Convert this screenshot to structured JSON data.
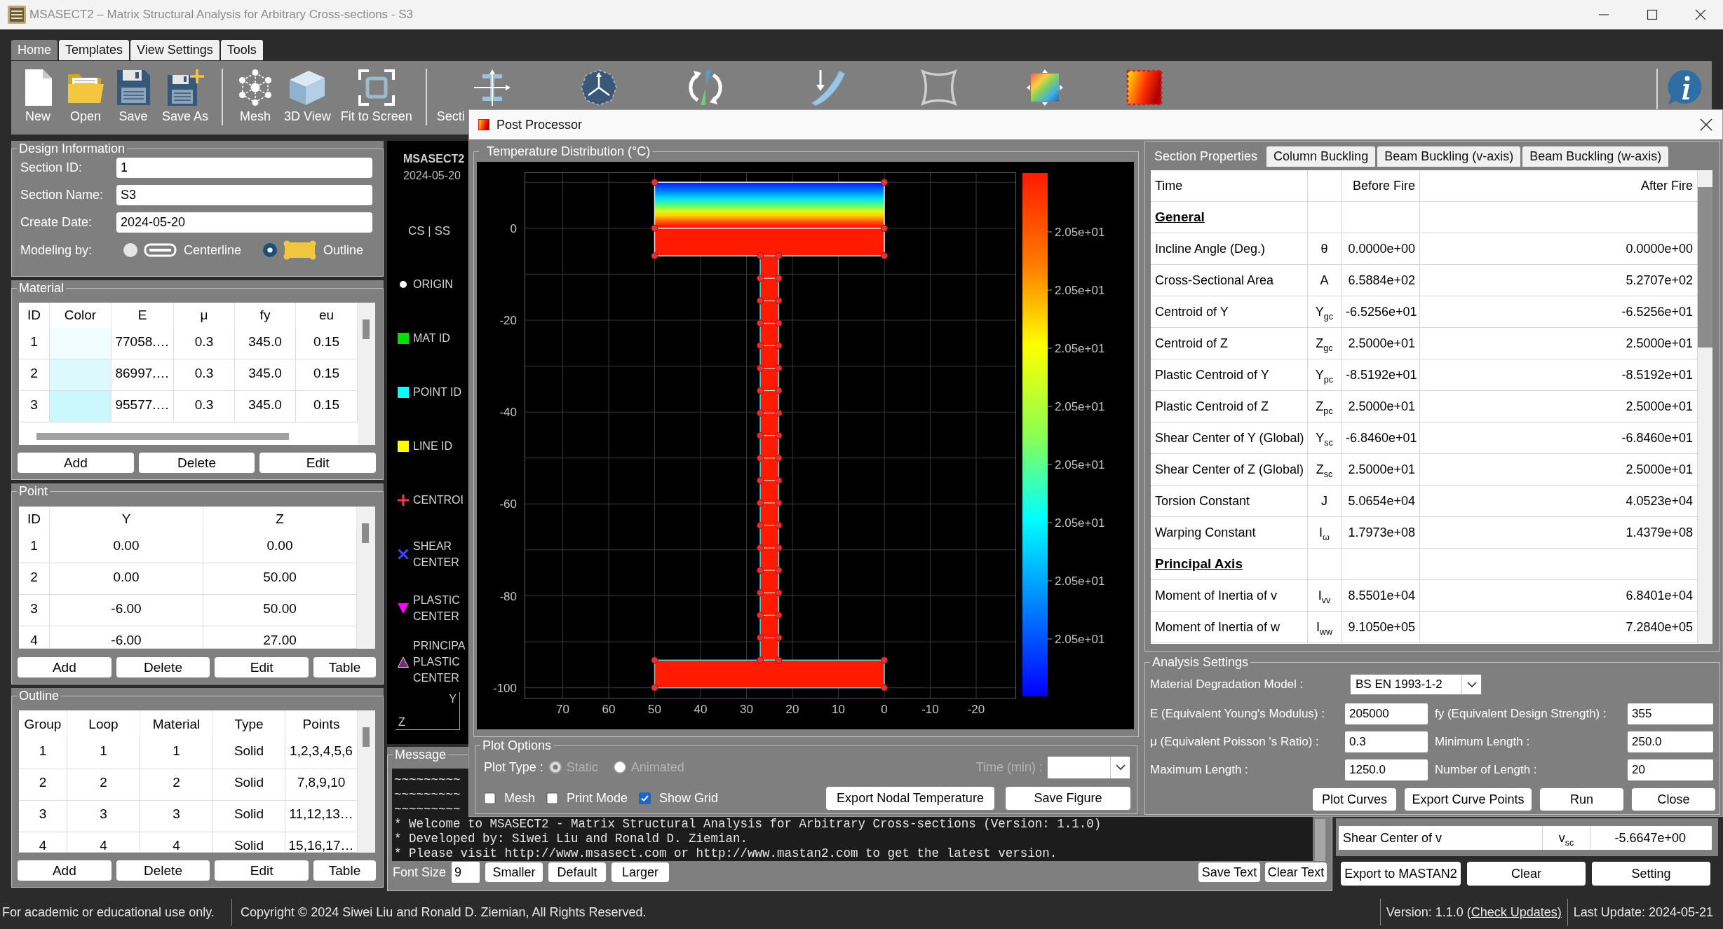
{
  "window": {
    "title": "MSASECT2 – Matrix Structural Analysis for Arbitrary Cross-sections - S3"
  },
  "ribbon": {
    "tabs": [
      {
        "label": "Home",
        "selected": true
      },
      {
        "label": "Templates",
        "selected": false
      },
      {
        "label": "View Settings",
        "selected": false
      },
      {
        "label": "Tools",
        "selected": false
      }
    ],
    "groups": [
      {
        "buttons": [
          {
            "kind": "new",
            "label": "New"
          },
          {
            "kind": "open",
            "label": "Open"
          },
          {
            "kind": "save",
            "label": "Save"
          },
          {
            "kind": "save_as",
            "label": "Save As"
          }
        ]
      },
      {
        "buttons": [
          {
            "kind": "mesh",
            "label": "Mesh"
          },
          {
            "kind": "view_3d",
            "label": "3D View"
          },
          {
            "kind": "fit",
            "label": "Fit to Screen"
          }
        ]
      },
      {
        "buttons": [
          {
            "kind": "section",
            "label": "Secti"
          },
          {
            "kind": "axes"
          },
          {
            "kind": "rotation"
          },
          {
            "kind": "curved_beam"
          },
          {
            "kind": "warping"
          },
          {
            "kind": "gradient"
          },
          {
            "kind": "heat_map"
          }
        ]
      }
    ]
  },
  "design_information": {
    "title": "Design Information",
    "fields": [
      {
        "label": "Section ID:",
        "value": "1"
      },
      {
        "label": "Section Name:",
        "value": "S3"
      },
      {
        "label": "Create Date:",
        "value": "2024-05-20"
      }
    ],
    "modeling": {
      "label": "Modeling by:",
      "options": [
        {
          "kind": "centerline",
          "label": "Centerline",
          "selected": false
        },
        {
          "kind": "outline",
          "label": "Outline",
          "selected": true
        }
      ]
    }
  },
  "material": {
    "title": "Material",
    "columns": [
      "ID",
      "Color",
      "E",
      "μ",
      "fy",
      "eu"
    ],
    "rows": [
      {
        "id": "1",
        "color": "#effdfe",
        "e": "77058.…",
        "mu": "0.3",
        "fy": "345.0",
        "eu": "0.15"
      },
      {
        "id": "2",
        "color": "#dcfafd",
        "e": "86997.…",
        "mu": "0.3",
        "fy": "345.0",
        "eu": "0.15"
      },
      {
        "id": "3",
        "color": "#cbf8fd",
        "e": "95577.…",
        "mu": "0.3",
        "fy": "345.0",
        "eu": "0.15"
      }
    ],
    "buttons": [
      "Add",
      "Delete",
      "Edit"
    ]
  },
  "point": {
    "title": "Point",
    "columns": [
      "ID",
      "Y",
      "Z"
    ],
    "rows": [
      [
        "1",
        "0.00",
        "0.00"
      ],
      [
        "2",
        "0.00",
        "50.00"
      ],
      [
        "3",
        "-6.00",
        "50.00"
      ],
      [
        "4",
        "-6.00",
        "27.00"
      ]
    ],
    "buttons": [
      "Add",
      "Delete",
      "Edit",
      "Table"
    ]
  },
  "outline": {
    "title": "Outline",
    "columns": [
      "Group",
      "Loop",
      "Material",
      "Type",
      "Points"
    ],
    "rows": [
      [
        "1",
        "1",
        "1",
        "Solid",
        "1,2,3,4,5,6"
      ],
      [
        "2",
        "2",
        "2",
        "Solid",
        "7,8,9,10"
      ],
      [
        "3",
        "3",
        "3",
        "Solid",
        "11,12,13…"
      ],
      [
        "4",
        "4",
        "4",
        "Solid",
        "15,16,17…"
      ]
    ],
    "buttons": [
      "Add",
      "Delete",
      "Edit",
      "Table"
    ]
  },
  "legend": {
    "title": "MSASECT2",
    "date": "2024-05-20",
    "mode": "CS | SS",
    "items": [
      {
        "kind": "dot",
        "color": "#ffffff",
        "label": "ORIGIN"
      },
      {
        "kind": "square",
        "color": "#00e000",
        "label": "MAT ID"
      },
      {
        "kind": "square",
        "color": "#00ffff",
        "label": "POINT ID"
      },
      {
        "kind": "square",
        "color": "#ffff00",
        "label": "LINE ID"
      },
      {
        "kind": "plus",
        "color": "#ff3b3b",
        "label": "CENTROI"
      },
      {
        "kind": "cross",
        "color": "#3b4bff",
        "label": "SHEAR CENTER"
      },
      {
        "kind": "triangle_down",
        "color": "#ff00ff",
        "label": "PLASTIC CENTER"
      },
      {
        "kind": "triangle_up",
        "color": "#7a2a7a",
        "label": "PRINCIPA PLASTIC CENTER"
      }
    ],
    "axes": {
      "y": "Y",
      "z": "Z"
    }
  },
  "message": {
    "title": "Message",
    "lines": [
      "~~~~~~~~~",
      "~~~~~~~~~",
      "~~~~~~~~~",
      "* Welcome to MSASECT2 - Matrix Structural Analysis for Arbitrary Cross-sections (Version: 1.1.0)",
      "* Developed by: Siwei Liu and Ronald D. Ziemian.",
      "* Please visit http://www.msasect.com or http://www.mastan2.com to get the latest version."
    ],
    "font_size": {
      "label": "Font Size",
      "value": "9"
    },
    "buttons": [
      "Smaller",
      "Default",
      "Larger"
    ],
    "log_buttons": [
      "Save Text",
      "Clear Text"
    ]
  },
  "section_properties": {
    "row": {
      "label": "Shear Center of v",
      "symbol": "v$_{sc}$",
      "value": "-5.6647e+00"
    },
    "buttons": [
      "Export to MASTAN2",
      "Clear",
      "Setting"
    ]
  },
  "post_processor": {
    "title": "Post Processor",
    "plot": {
      "title": "Temperature Distribution (°C)",
      "x_ticks": [
        "70",
        "60",
        "50",
        "40",
        "30",
        "20",
        "10",
        "0",
        "-10",
        "-20"
      ],
      "y_ticks": [
        "0",
        "-20",
        "-40",
        "-60",
        "-80",
        "-100"
      ],
      "colorbar_labels": [
        "2.05e+01",
        "2.05e+01",
        "2.05e+01",
        "2.05e+01",
        "2.05e+01",
        "2.05e+01",
        "2.05e+01",
        "2.05e+01"
      ]
    },
    "plot_options": {
      "title": "Plot Options",
      "plot_type": {
        "label": "Plot Type :",
        "options": [
          {
            "label": "Static",
            "selected": true,
            "disabled": true
          },
          {
            "label": "Animated",
            "selected": false,
            "disabled": true
          }
        ]
      },
      "time": {
        "label": "Time (min) :",
        "disabled": true
      },
      "checkboxes": [
        {
          "label": "Mesh",
          "checked": false
        },
        {
          "label": "Print Mode",
          "checked": false
        },
        {
          "label": "Show Grid",
          "checked": true
        }
      ],
      "buttons": [
        "Export Nodal Temperature",
        "Save Figure"
      ]
    },
    "tabs": [
      {
        "label": "Section Properties",
        "selected": true
      },
      {
        "label": "Column Buckling",
        "selected": false
      },
      {
        "label": "Beam Buckling (v-axis)",
        "selected": false
      },
      {
        "label": "Beam Buckling (w-axis)",
        "selected": false
      }
    ],
    "table": {
      "header": {
        "label": "Time",
        "before": "Before Fire",
        "after": "After Fire"
      },
      "rows": [
        {
          "kind": "heading",
          "label": "General"
        },
        {
          "kind": "value",
          "label": "Incline Angle (Deg.)",
          "symbol": "θ",
          "before": "0.0000e+00",
          "after": "0.0000e+00"
        },
        {
          "kind": "value",
          "label": "Cross-Sectional Area",
          "symbol": "A",
          "before": "6.5884e+02",
          "after": "5.2707e+02"
        },
        {
          "kind": "value",
          "label": "Centroid of Y",
          "symbol": "Y$_{gc}$",
          "before": "-6.5256e+01",
          "after": "-6.5256e+01"
        },
        {
          "kind": "value",
          "label": "Centroid of Z",
          "symbol": "Z$_{gc}$",
          "before": "2.5000e+01",
          "after": "2.5000e+01"
        },
        {
          "kind": "value",
          "label": "Plastic Centroid of Y",
          "symbol": "Y$_{pc}$",
          "before": "-8.5192e+01",
          "after": "-8.5192e+01"
        },
        {
          "kind": "value",
          "label": "Plastic Centroid of Z",
          "symbol": "Z$_{pc}$",
          "before": "2.5000e+01",
          "after": "2.5000e+01"
        },
        {
          "kind": "value",
          "label": "Shear Center of Y (Global)",
          "symbol": "Y$_{sc}$",
          "before": "-6.8460e+01",
          "after": "-6.8460e+01"
        },
        {
          "kind": "value",
          "label": "Shear Center of Z (Global)",
          "symbol": "Z$_{sc}$",
          "before": "2.5000e+01",
          "after": "2.5000e+01"
        },
        {
          "kind": "value",
          "label": "Torsion Constant",
          "symbol": "J",
          "before": "5.0654e+04",
          "after": "4.0523e+04"
        },
        {
          "kind": "value",
          "label": "Warping Constant",
          "symbol": "I$_{ω}$",
          "before": "1.7973e+08",
          "after": "1.4379e+08"
        },
        {
          "kind": "heading",
          "label": "Principal Axis"
        },
        {
          "kind": "value",
          "label": "Moment of Inertia of v",
          "symbol": "I$_{vv}$",
          "before": "8.5501e+04",
          "after": "6.8401e+04"
        },
        {
          "kind": "value",
          "label": "Moment of Inertia of w",
          "symbol": "I$_{ww}$",
          "before": "9.1050e+05",
          "after": "7.2840e+05"
        }
      ]
    },
    "analysis": {
      "title": "Analysis Settings",
      "model": {
        "label": "Material Degradation Model :",
        "value": "BS EN 1993-1-2"
      },
      "fields": [
        {
          "label": "E (Equivalent Young's Modulus) :",
          "value": "205000"
        },
        {
          "label": "fy (Equivalent Design Strength) :",
          "value": "355"
        },
        {
          "label": "μ (Equivalent Poisson 's Ratio) :",
          "value": "0.3"
        },
        {
          "label": "Minimum Length :",
          "value": "250.0"
        },
        {
          "label": "Maximum Length :",
          "value": "1250.0"
        },
        {
          "label": "Number of Length :",
          "value": "20"
        }
      ],
      "buttons": [
        "Plot Curves",
        "Export Curve Points",
        "Run",
        "Close"
      ]
    }
  },
  "status_bar": {
    "notice": "For academic or educational use only.",
    "copyright": "Copyright © 2024 Siwei Liu and Ronald D. Ziemian, All Rights Reserved.",
    "version": "Version: 1.1.0",
    "link": "(Check Updates)",
    "last_update": "Last Update: 2024-05-21"
  }
}
